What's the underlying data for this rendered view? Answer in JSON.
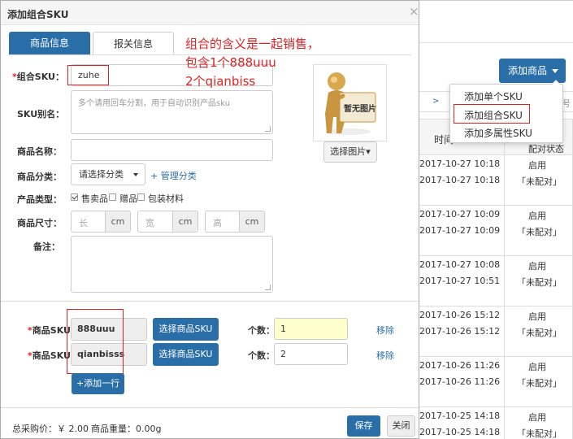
{
  "background": {
    "add_product_button": "添加商品",
    "filter_left": ">",
    "filter_right": "号",
    "table": {
      "time_header": "时间",
      "status_header": "配对状态",
      "rows": [
        {
          "date1": "2017-10-27 10:18",
          "date2": "2017-10-27 10:18",
          "status": "启用",
          "pair": "「未配对」"
        },
        {
          "date1": "2017-10-27 10:09",
          "date2": "2017-10-27 10:09",
          "status": "启用",
          "pair": "「未配对」"
        },
        {
          "date1": "2017-10-27 10:08",
          "date2": "2017-10-27 10:51",
          "status": "启用",
          "pair": "「未配对」"
        },
        {
          "date1": "2017-10-26 15:12",
          "date2": "2017-10-26 15:12",
          "status": "启用",
          "pair": "「未配对」"
        },
        {
          "date1": "2017-10-26 11:26",
          "date2": "2017-10-26 11:26",
          "status": "启用",
          "pair": "「未配对」"
        },
        {
          "date1": "2017-10-25 14:18",
          "date2": "2017-10-25 14:18",
          "status": "启用",
          "pair": "「未配对」"
        }
      ]
    },
    "dropdown": [
      "添加单个SKU",
      "添加组合SKU",
      "添加多属性SKU"
    ]
  },
  "modal": {
    "title": "添加组合SKU",
    "close": "×",
    "tabs": [
      "商品信息",
      "报关信息"
    ],
    "fields": {
      "combo_sku_label": "组合SKU：",
      "combo_sku_value": "zuhe",
      "alias_label": "SKU别名：",
      "alias_placeholder": "多个请用回车分割，用于自动识别产品sku",
      "name_label": "商品名称：",
      "category_label": "商品分类：",
      "category_select": "请选择分类",
      "manage_category": "+ 管理分类",
      "type_label": "产品类型：",
      "types": [
        "售卖品",
        "赠品",
        "包装材料"
      ],
      "size_label": "商品尺寸：",
      "size_units": [
        {
          "placeholder": "长",
          "unit": "cm"
        },
        {
          "placeholder": "宽",
          "unit": "cm"
        },
        {
          "placeholder": "高",
          "unit": "cm"
        }
      ],
      "note_label": "备注："
    },
    "image": {
      "no_image": "暂无图片",
      "choose_button": "选择图片▾"
    },
    "sku_rows": [
      {
        "label": "商品SKU：",
        "value": "888uuu",
        "button": "选择商品SKU",
        "count_label": "个数：",
        "count": "1",
        "remove": "移除"
      },
      {
        "label": "商品SKU：",
        "value": "qianbisss",
        "button": "选择商品SKU",
        "count_label": "个数：",
        "count": "2",
        "remove": "移除"
      }
    ],
    "add_row_button": "+添加一行",
    "footer": {
      "total_price": "总采购价：￥ 2.00",
      "weight": "商品重量：0.00g",
      "save": "保存",
      "close": "关闭"
    }
  },
  "annotation": {
    "line1": "组合的含义是一起销售，",
    "line2": "包含1个888uuu",
    "line3": "2个qianbiss"
  },
  "colors": {
    "primary": "#2a6ea8",
    "annotation_red": "#e02222",
    "highlight_yellow": "#ffffcc"
  }
}
